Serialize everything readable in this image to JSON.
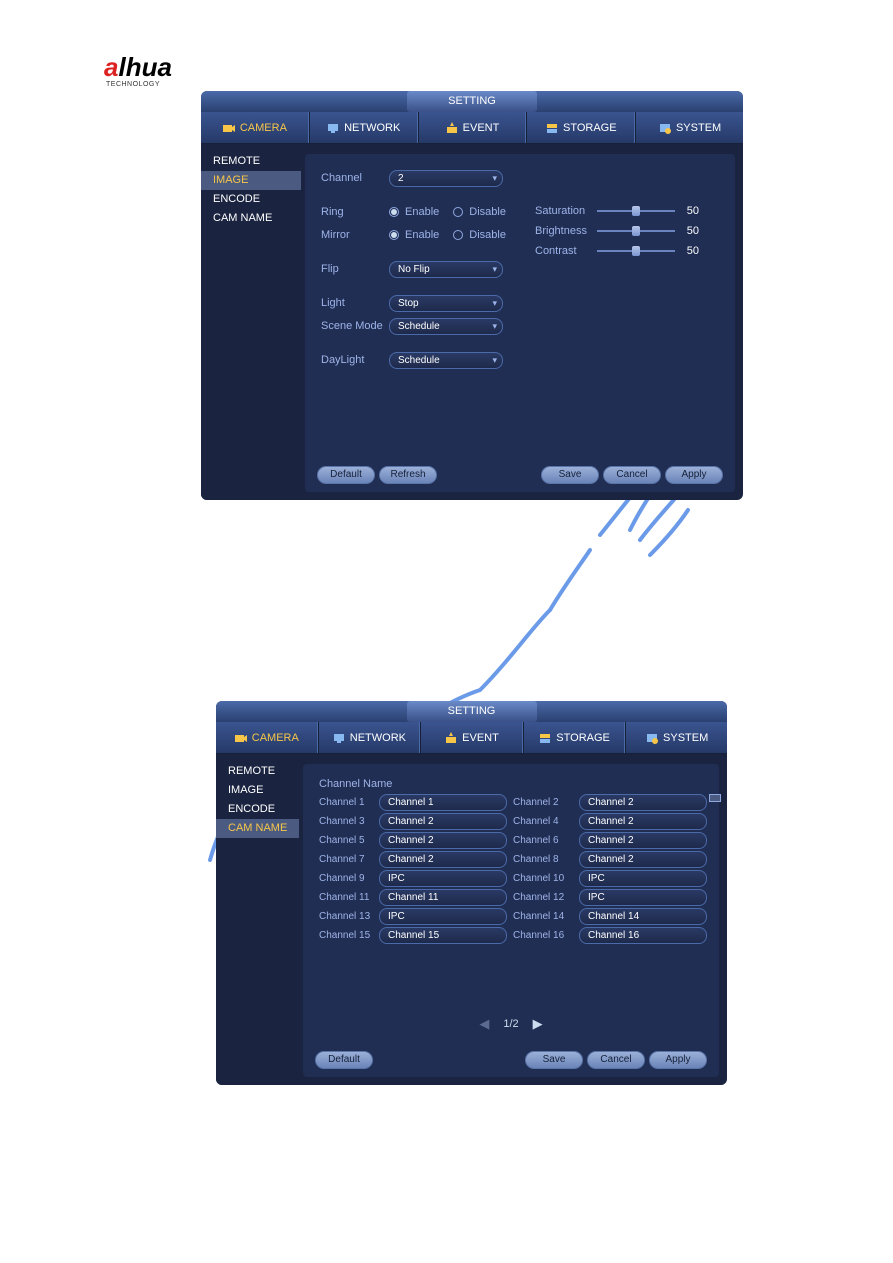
{
  "logo": {
    "brand_a": "a",
    "brand_lhua": "lhua",
    "sub": "TECHNOLOGY"
  },
  "panel_title": "SETTING",
  "tabs": {
    "camera": "CAMERA",
    "network": "NETWORK",
    "event": "EVENT",
    "storage": "STORAGE",
    "system": "SYSTEM"
  },
  "sidebar": {
    "remote": "REMOTE",
    "image": "IMAGE",
    "encode": "ENCODE",
    "camname": "CAM NAME"
  },
  "image_page": {
    "labels": {
      "channel": "Channel",
      "ring": "Ring",
      "mirror": "Mirror",
      "flip": "Flip",
      "light": "Light",
      "scene_mode": "Scene Mode",
      "daylight": "DayLight"
    },
    "values": {
      "channel": "2",
      "ring": "enable",
      "mirror": "enable",
      "flip": "No Flip",
      "light": "Stop",
      "scene_mode": "Schedule",
      "daylight": "Schedule"
    },
    "radio": {
      "enable": "Enable",
      "disable": "Disable"
    },
    "sliders": {
      "saturation": {
        "label": "Saturation",
        "value": 50
      },
      "brightness": {
        "label": "Brightness",
        "value": 50
      },
      "contrast": {
        "label": "Contrast",
        "value": 50
      }
    },
    "buttons": {
      "default": "Default",
      "refresh": "Refresh",
      "save": "Save",
      "cancel": "Cancel",
      "apply": "Apply"
    }
  },
  "camname_page": {
    "header": "Channel Name",
    "rows": [
      {
        "l_lbl": "Channel 1",
        "l_val": "Channel 1",
        "r_lbl": "Channel 2",
        "r_val": "Channel 2"
      },
      {
        "l_lbl": "Channel 3",
        "l_val": "Channel 2",
        "r_lbl": "Channel 4",
        "r_val": "Channel 2"
      },
      {
        "l_lbl": "Channel 5",
        "l_val": "Channel 2",
        "r_lbl": "Channel 6",
        "r_val": "Channel 2"
      },
      {
        "l_lbl": "Channel 7",
        "l_val": "Channel 2",
        "r_lbl": "Channel 8",
        "r_val": "Channel 2"
      },
      {
        "l_lbl": "Channel 9",
        "l_val": "IPC",
        "r_lbl": "Channel 10",
        "r_val": "IPC"
      },
      {
        "l_lbl": "Channel 11",
        "l_val": "Channel 11",
        "r_lbl": "Channel 12",
        "r_val": "IPC"
      },
      {
        "l_lbl": "Channel 13",
        "l_val": "IPC",
        "r_lbl": "Channel 14",
        "r_val": "Channel 14"
      },
      {
        "l_lbl": "Channel 15",
        "l_val": "Channel 15",
        "r_lbl": "Channel 16",
        "r_val": "Channel 16"
      }
    ],
    "pager": {
      "page": "1/2"
    },
    "buttons": {
      "default": "Default",
      "save": "Save",
      "cancel": "Cancel",
      "apply": "Apply"
    }
  }
}
